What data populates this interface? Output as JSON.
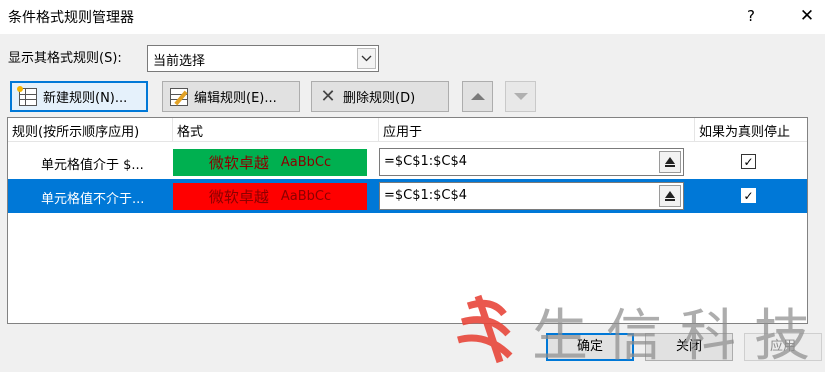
{
  "window": {
    "title": "条件格式规则管理器",
    "help": "?",
    "close": "✕"
  },
  "show_rules": {
    "label": "显示其格式规则(S):",
    "value": "当前选择"
  },
  "toolbar": {
    "new_rule": "新建规则(N)...",
    "edit_rule": "编辑规则(E)...",
    "delete_rule": "删除规则(D)"
  },
  "table": {
    "headers": {
      "rule": "规则(按所示顺序应用)",
      "format": "格式",
      "applies_to": "应用于",
      "stop_if_true": "如果为真则停止"
    },
    "rows": [
      {
        "rule": "单元格值介于 $...",
        "format_text": "微软卓越",
        "format_sample": "AaBbCc",
        "format_color": "#00b050",
        "applies_to": "=$C$1:$C$4",
        "stop_if_true": "✓"
      },
      {
        "rule": "单元格值不介于...",
        "format_text": "微软卓越",
        "format_sample": "AaBbCc",
        "format_color": "#ff0000",
        "applies_to": "=$C$1:$C$4",
        "stop_if_true": "✓"
      }
    ]
  },
  "footer": {
    "ok": "确定",
    "close": "关闭",
    "apply": "应用"
  },
  "watermark": {
    "text": "生信科技"
  },
  "colors": {
    "selection": "#0078d7",
    "button_border_default": "#0078d7",
    "logo_red": "#e8473b"
  }
}
